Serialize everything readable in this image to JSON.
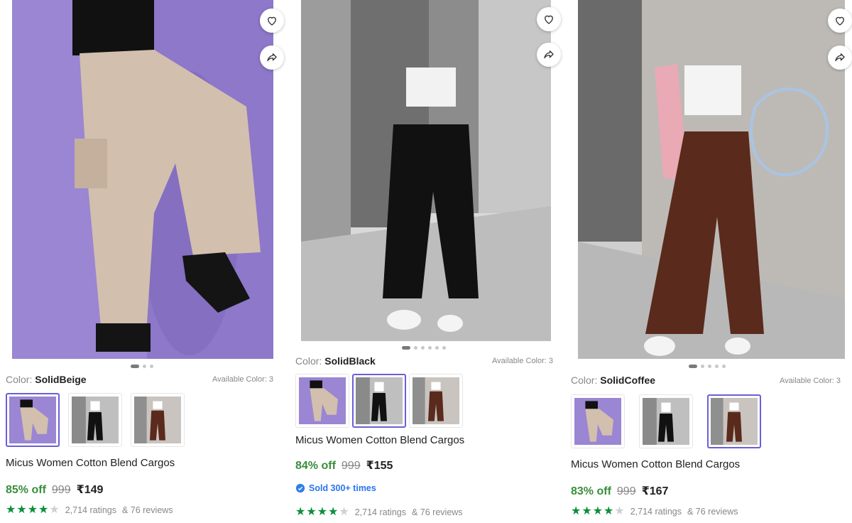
{
  "colors": {
    "accent_green": "#388e3c",
    "star_green": "#0b8f3a",
    "selected_border": "#6a5fd6",
    "link_blue": "#2874f0"
  },
  "cards": [
    {
      "color_label": "Color:",
      "color_value": "SolidBeige",
      "available": "Available Color: 3",
      "name": "Micus Women Cotton Blend Cargos",
      "discount": "85% off",
      "mrp": "999",
      "price": "₹149",
      "rating_stars": 4,
      "ratings": "2,714 ratings",
      "reviews": "& 76 reviews",
      "icons": [
        "heart-icon",
        "share-icon"
      ]
    },
    {
      "color_label": "Color:",
      "color_value": "SolidBlack",
      "available": "Available Color: 3",
      "name": "Micus Women Cotton Blend Cargos",
      "discount": "84% off",
      "mrp": "999",
      "price": "₹155",
      "sold": "Sold 300+ times",
      "rating_stars": 4,
      "ratings": "2,714 ratings",
      "reviews": "& 76 reviews",
      "icons": [
        "heart-icon",
        "share-icon"
      ]
    },
    {
      "color_label": "Color:",
      "color_value": "SolidCoffee",
      "available": "Available Color: 3",
      "name": "Micus Women Cotton Blend Cargos",
      "discount": "83% off",
      "mrp": "999",
      "price": "₹167",
      "rating_stars": 4,
      "ratings": "2,714 ratings",
      "reviews": "& 76 reviews",
      "icons": [
        "heart-icon",
        "share-icon"
      ]
    }
  ]
}
